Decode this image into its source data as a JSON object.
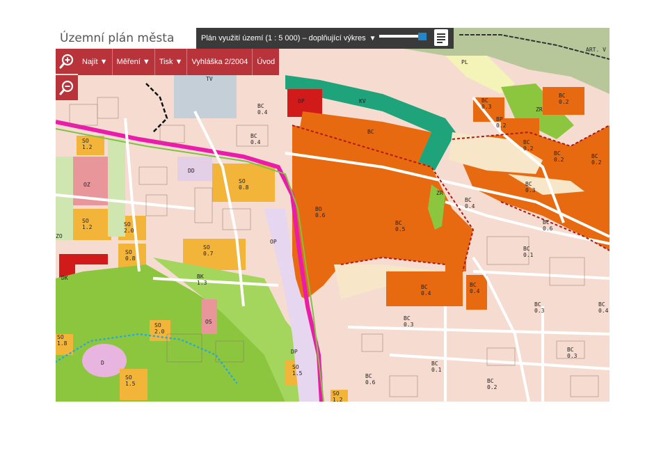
{
  "app": {
    "title": "Územní plán města Brna",
    "layer_selector": "Plán využití území (1 : 5 000) – doplňující výkres",
    "layer_arrow": "▼"
  },
  "toolbar": {
    "items": [
      "Najít ▼",
      "Měření ▼",
      "Tisk ▼",
      "Vyhláška 2/2004",
      "Úvod"
    ]
  },
  "zoom": {
    "in_icon": "zoom-in-icon",
    "out_icon": "zoom-out-icon"
  },
  "colors": {
    "toolbar_red": "#b9333b",
    "residential_pink": "#f6dcd0",
    "orange_bc": "#e86a10",
    "sports_yellow": "#f2b53a",
    "green_zr": "#8cc63f",
    "forest_gray_green": "#b7c79a",
    "teal_kv": "#1fa37a",
    "road_magenta": "#ec1cab",
    "industrial_red": "#d11b1b",
    "civic_gray_blue": "#c5cfd8"
  },
  "map_labels": {
    "tv": "TV",
    "pl": "PL",
    "kv": "KV",
    "op1": "OP",
    "zr": "ZR",
    "dd": "DD",
    "bc_03a": "BC\n0.3",
    "bc_02a": "BC\n0.2",
    "bp_02": "BP\n0.2",
    "bc_04a": "BC\n0.4",
    "bc_04b": "BC\n0.4",
    "bc_top": "BC",
    "bc_02b": "BC\n0.2",
    "bc_02c": "BC\n0.2",
    "bc_02d": "BC\n0.2",
    "bc_03b": "BC\n0.3",
    "so_12a": "SO\n1.2",
    "oz": "OZ",
    "so_08a": "SO\n0.8",
    "zr2": "ZR",
    "bo_06": "BO\n0.6",
    "bc_05": "BC\n0.5",
    "bc_04c": "BC\n0.4",
    "bc_06": "BC\n0.6",
    "so_12b": "SO\n1.2",
    "so_20a": "SO\n2.0",
    "zo": "ZO",
    "op2": "OP",
    "so_07": "SO\n0.7",
    "bc_01": "BC\n0.1",
    "so_08b": "SO\n0.8",
    "bk_13": "BK\n1.3",
    "bc_04d": "BC\n0.4",
    "bc_04e": "BC\n0.4",
    "dk": "DK",
    "bc_03c": "BC\n0.3",
    "bc_04f": "BC\n0.4",
    "os": "OS",
    "so_20b": "SO\n2.0",
    "so_18": "SO\n1.8",
    "bc_03d": "BC\n0.3",
    "dp": "DP",
    "d": "D",
    "bc_01b": "BC\n0.1",
    "bc_03e": "BC\n0.3",
    "so_15a": "SO\n1.5",
    "so_15b": "SO\n1.5",
    "bc_06b": "BC\n0.6",
    "bc_02e": "BC\n0.2",
    "so_12c": "SO\n1.2",
    "art": "ART. V"
  }
}
